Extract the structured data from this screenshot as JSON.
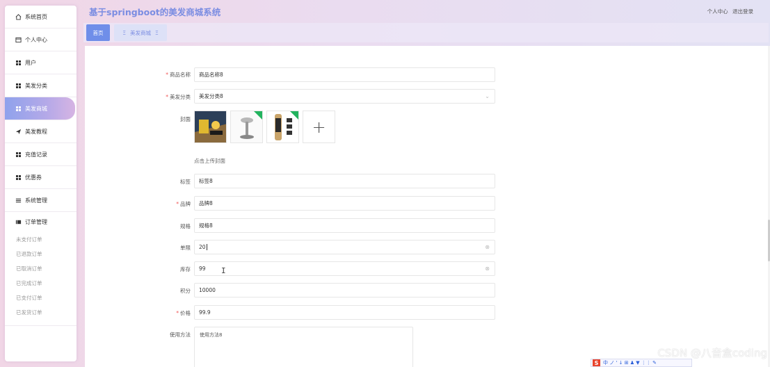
{
  "header": {
    "title": "基于springboot的美发商城系统",
    "links": [
      "个人中心",
      "退出登录"
    ]
  },
  "sidebar": {
    "items": [
      {
        "label": "系统首页",
        "icon": "home-icon"
      },
      {
        "label": "个人中心",
        "icon": "window-icon"
      },
      {
        "label": "用户",
        "icon": "grid-icon"
      },
      {
        "label": "美发分类",
        "icon": "grid-icon"
      },
      {
        "label": "美发商城",
        "icon": "grid-icon",
        "active": true
      },
      {
        "label": "美发教程",
        "icon": "send-icon"
      },
      {
        "label": "充值记录",
        "icon": "grid-icon"
      },
      {
        "label": "优惠券",
        "icon": "grid-icon"
      },
      {
        "label": "系统管理",
        "icon": "menu-icon"
      },
      {
        "label": "订单管理",
        "icon": "order-icon"
      }
    ],
    "order_sub": [
      "未支付订单",
      "已退款订单",
      "已取消订单",
      "已完成订单",
      "已支付订单",
      "已发货订单"
    ]
  },
  "tabs": {
    "home": "首页",
    "mall": "美发商城"
  },
  "form": {
    "name_label": "商品名称",
    "name_value": "商品名称8",
    "category_label": "美发分类",
    "category_value": "美发分类8",
    "cover_label": "封面",
    "cover_add": "+",
    "upload_tip": "点击上传封面",
    "tag_label": "标签",
    "tag_value": "标签8",
    "brand_label": "品牌",
    "brand_value": "品牌8",
    "spec_label": "规格",
    "spec_value": "规格8",
    "limit_label": "单限",
    "limit_value": "20",
    "stock_label": "库存",
    "stock_value": "99",
    "points_label": "积分",
    "points_value": "10000",
    "price_label": "价格",
    "price_value": "99.9",
    "usage_label": "使用方法",
    "usage_value": "使用方法8",
    "required_mark": "*"
  },
  "watermark": "CSDN @八音盒coding",
  "ime": {
    "logo": "S",
    "chars": "中 ノ ' ↓ ⊞ ♟ ▼ ⋮⋮ ✎"
  },
  "colors": {
    "accent": "#6f8ee9",
    "title": "#7b8de2",
    "required": "#f05656",
    "badge": "#22b35e"
  }
}
